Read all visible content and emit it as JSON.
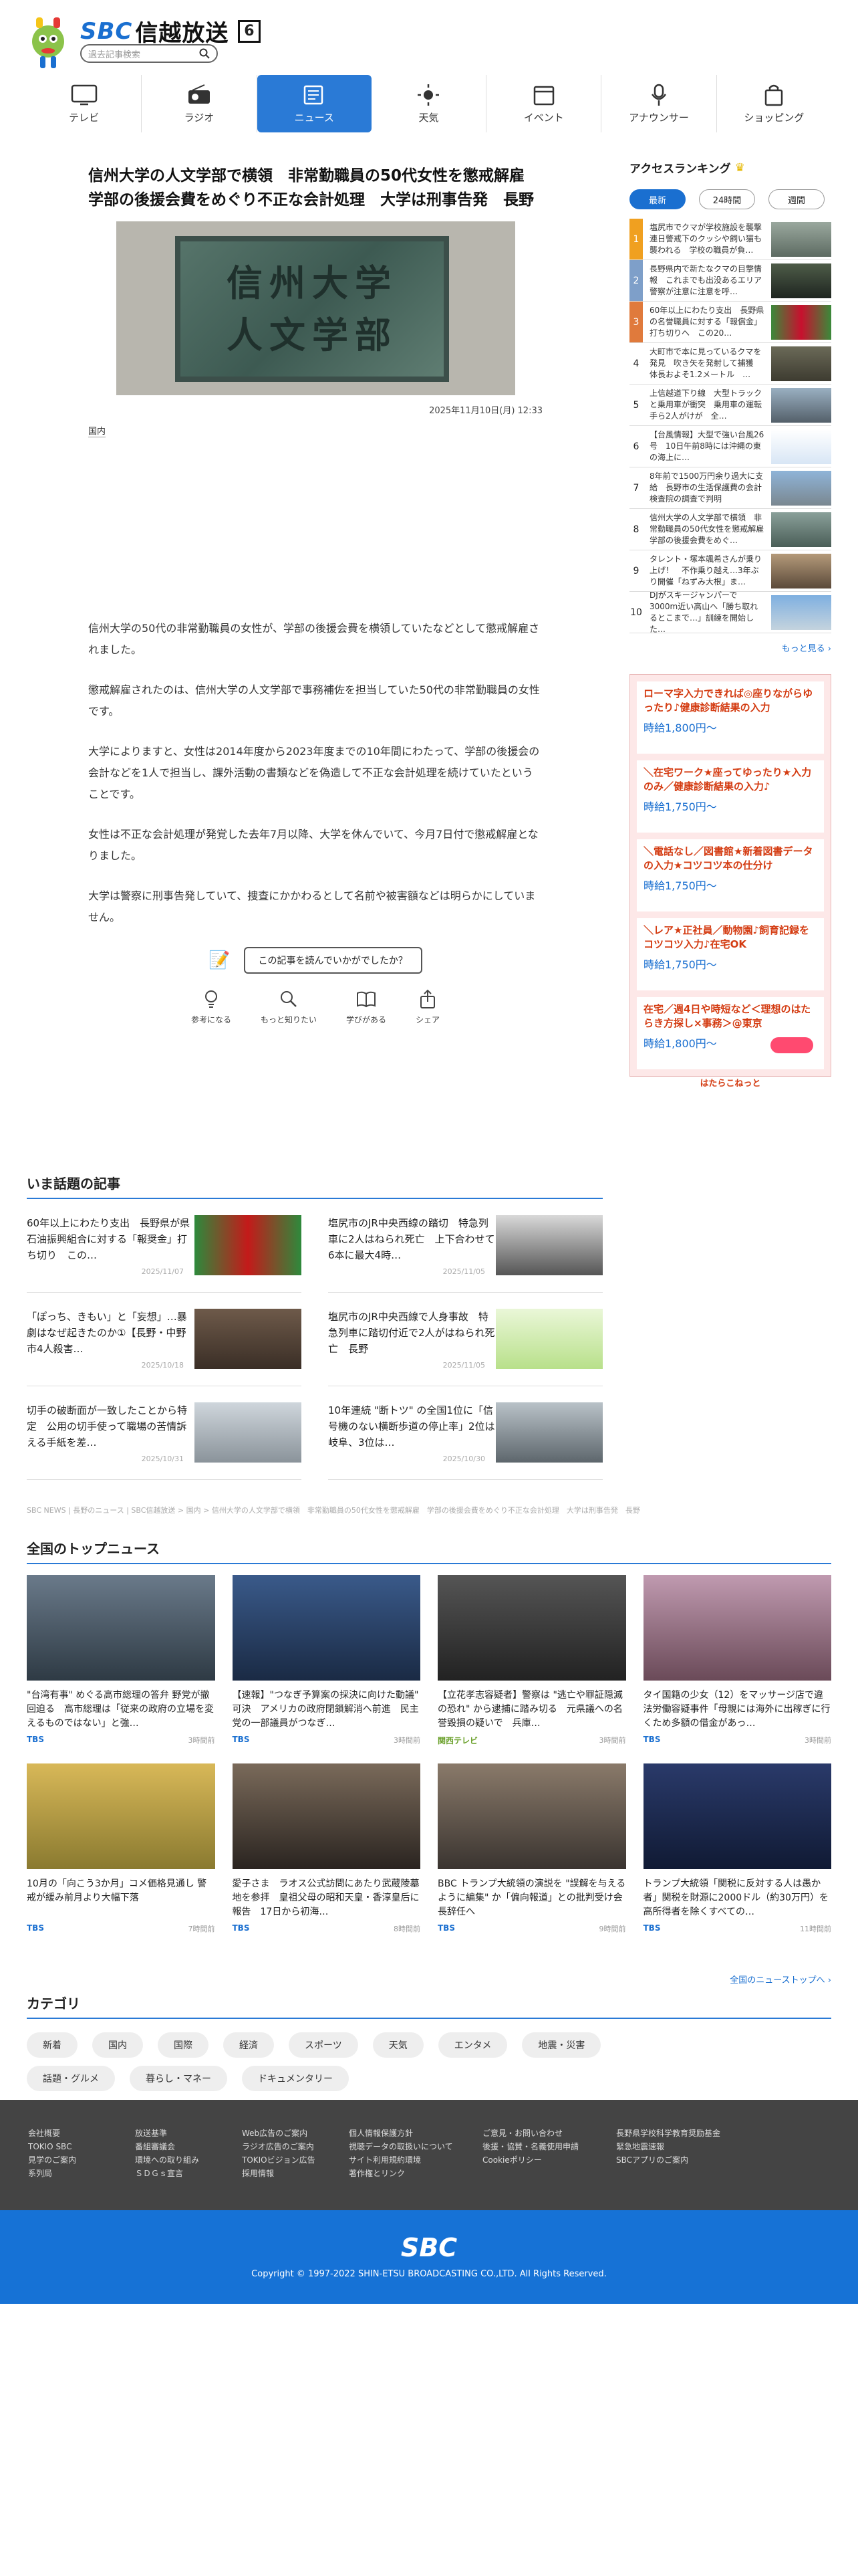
{
  "header": {
    "logo_sbc": "SBC",
    "logo_name": "信越放送",
    "channel": "6",
    "search_placeholder": "過去記事検索"
  },
  "nav": [
    {
      "label": "テレビ",
      "icon": "tv-icon"
    },
    {
      "label": "ラジオ",
      "icon": "radio-icon"
    },
    {
      "label": "ニュース",
      "icon": "news-icon",
      "active": true
    },
    {
      "label": "天気",
      "icon": "sun-icon"
    },
    {
      "label": "イベント",
      "icon": "calendar-icon"
    },
    {
      "label": "アナウンサー",
      "icon": "microphone-icon"
    },
    {
      "label": "ショッピング",
      "icon": "shopping-bag-icon"
    }
  ],
  "article": {
    "title": "信州大学の人文学部で横領　非常勤職員の50代女性を懲戒解雇　学部の後援会費をめぐり不正な会計処理　大学は刑事告発　長野",
    "plaque_line1": "信州大学",
    "plaque_line2": "人文学部",
    "date": "2025年11月10日(月) 12:33",
    "tag": "国内",
    "paragraphs": [
      "信州大学の50代の非常勤職員の女性が、学部の後援会費を横領していたなどとして懲戒解雇されました。",
      "懲戒解雇されたのは、信州大学の人文学部で事務補佐を担当していた50代の非常勤職員の女性です。",
      "大学によりますと、女性は2014年度から2023年度までの10年間にわたって、学部の後援会の会計などを1人で担当し、課外活動の書類などを偽造して不正な会計処理を続けていたということです。",
      "女性は不正な会計処理が発覚した去年7月以降、大学を休んでいて、今月7日付で懲戒解雇となりました。",
      "大学は警察に刑事告発していて、捜査にかかわるとして名前や被害額などは明らかにしていません。"
    ],
    "feedback_question": "この記事を読んでいかがでしたか？",
    "reactions": [
      {
        "label": "参考になる",
        "icon": "lightbulb-icon"
      },
      {
        "label": "もっと知りたい",
        "icon": "magnifier-icon"
      },
      {
        "label": "学びがある",
        "icon": "book-icon"
      },
      {
        "label": "シェア",
        "icon": "share-icon"
      }
    ]
  },
  "ranking": {
    "title": "アクセスランキング",
    "tabs": [
      "最新",
      "24時間",
      "週間"
    ],
    "items": [
      {
        "n": "1",
        "text": "塩尻市でクマが学校施設を襲撃　連日警戒下のクッシや飼い猫も襲われる　学校の職員が負…"
      },
      {
        "n": "2",
        "text": "長野県内で新たなクマの目撃情報　これまでも出没あるエリア　警察が注意に注意を呼…"
      },
      {
        "n": "3",
        "text": "60年以上にわたり支出　長野県の名誉職員に対する「報償金」打ち切りへ　この20…"
      },
      {
        "n": "4",
        "text": "大町市で本に見っているクマを発見　吹き矢を発射して捕獲　体長およそ1.2メートル　…"
      },
      {
        "n": "5",
        "text": "上信越道下り線　大型トラックと乗用車が衝突　乗用車の運転手ら2人がけが　全…"
      },
      {
        "n": "6",
        "text": "【台風情報】大型で強い台風26号　10日午前8時には沖縄の東の海上に…"
      },
      {
        "n": "7",
        "text": "8年前で1500万円余り過大に支給　長野市の生活保護費の会計検査院の調査で判明"
      },
      {
        "n": "8",
        "text": "信州大学の人文学部で横領　非常勤職員の50代女性を懲戒解雇　学部の後援会費をめぐ…"
      },
      {
        "n": "9",
        "text": "タレント・塚本颯希さんが乗り上げ！　不作乗り越え…3年ぶり開催「ねずみ大根」ま…"
      },
      {
        "n": "10",
        "text": "DJがスキージャンパーで3000m近い高山へ「勝ち取れるとこまで…」訓練を開始した…"
      }
    ],
    "more": "もっと見る"
  },
  "ad": {
    "blocks": [
      {
        "text": "ローマ字入力できれば◎座りながらゆったり♪健康診断結果の入力",
        "price": "時給1,800円〜"
      },
      {
        "text": "＼在宅ワーク★座ってゆったり★入力のみ／健康診断結果の入力♪",
        "price": "時給1,750円〜"
      },
      {
        "text": "＼電話なし／図書館★新着図書データの入力★コツコツ本の仕分け",
        "price": "時給1,750円〜"
      },
      {
        "text": "＼レア★正社員／動物園♪飼育記録をコツコツ入力♪在宅OK",
        "price": "時給1,750円〜"
      },
      {
        "text": "在宅／週4日や時短など＜理想のはたらき方探し×事務＞@東京",
        "price": "時給1,800円〜"
      }
    ],
    "footer": "はたらこねっと"
  },
  "hot": {
    "title": "いま話題の記事",
    "items": [
      {
        "text": "60年以上にわたり支出　長野県が県石油振興組合に対する「報奨金」打ち切り　この…",
        "date": "2025/11/07"
      },
      {
        "text": "塩尻市のJR中央西線の踏切　特急列車に2人はねられ死亡　上下合わせて6本に最大4時…",
        "date": "2025/11/05"
      },
      {
        "text": "「ぽっち、きもい」と「妄想」…暴劇はなぜ起きたのか①【長野・中野市4人殺害…",
        "date": "2025/10/18"
      },
      {
        "text": "塩尻市のJR中央西線で人身事故　特急列車に踏切付近で2人がはねられ死亡　長野",
        "date": "2025/11/05"
      },
      {
        "text": "切手の破断面が一致したことから特定　公用の切手使って職場の苦情訴える手紙を差…",
        "date": "2025/10/31"
      },
      {
        "text": "10年連続 \"断トツ\" の全国1位に「信号機のない横断歩道の停止率」2位は岐阜、3位は…",
        "date": "2025/10/30"
      }
    ]
  },
  "breadcrumb": "SBC NEWS | 長野のニュース | SBC信越放送 > 国内 > 信州大学の人文学部で横領　非常勤職員の50代女性を懲戒解雇　学部の後援会費をめぐり不正な会計処理　大学は刑事告発　長野",
  "topnews": {
    "title": "全国のトップニュース",
    "items": [
      {
        "text": "\"台湾有事\" めぐる高市総理の答弁 野党が撤回迫る　高市総理は「従来の政府の立場を変えるものではない」と強…",
        "src": "TBS",
        "ago": "3時間前"
      },
      {
        "text": "【速報】\"つなぎ予算案の採決に向けた動議\" 可決　アメリカの政府閉鎖解消へ前進　民主党の一部議員がつなぎ…",
        "src": "TBS",
        "ago": "3時間前"
      },
      {
        "text": "【立花孝志容疑者】警察は \"逃亡や罪証隠滅の恐れ\" から逮捕に踏み切る　元県議への名誉毀損の疑いで　兵庫…",
        "src": "関西テレビ",
        "ago": "3時間前"
      },
      {
        "text": "タイ国籍の少女（12）をマッサージ店で違法労働容疑事件「母親には海外に出稼ぎに行くため多額の借金があっ…",
        "src": "TBS",
        "ago": "3時間前"
      },
      {
        "text": "10月の「向こう3か月」コメ価格見通し 警戒が緩み前月より大幅下落",
        "src": "TBS",
        "ago": "7時間前"
      },
      {
        "text": "愛子さま　ラオス公式訪問にあたり武蔵陵墓地を参拝　皇祖父母の昭和天皇・香淳皇后に報告　17日から初海…",
        "src": "TBS",
        "ago": "8時間前"
      },
      {
        "text": "BBC トランプ大統領の演説を \"誤解を与えるように編集\" か「偏向報道」との批判受け会長辞任へ",
        "src": "TBS",
        "ago": "9時間前"
      },
      {
        "text": "トランプ大統領「関税に反対する人は愚か者」関税を財源に2000ドル（約30万円）を高所得者を除くすべての…",
        "src": "TBS",
        "ago": "11時間前"
      }
    ],
    "more": "全国のニューストップへ"
  },
  "categories": {
    "title": "カテゴリ",
    "items": [
      "新着",
      "国内",
      "国際",
      "経済",
      "スポーツ",
      "天気",
      "エンタメ",
      "地震・災害",
      "話題・グルメ",
      "暮らし・マネー",
      "ドキュメンタリー"
    ]
  },
  "footer": {
    "cols": [
      [
        "会社概要",
        "TOKIO SBC",
        "見学のご案内",
        "系列局"
      ],
      [
        "放送基準",
        "番組審議会",
        "環境への取り組み",
        "ＳＤＧｓ宣言"
      ],
      [
        "Web広告のご案内",
        "ラジオ広告のご案内",
        "TOKIOビジョン広告",
        "採用情報"
      ],
      [
        "個人情報保護方針",
        "視聴データの取扱いについて",
        "サイト利用規約環境",
        "著作権とリンク"
      ],
      [
        "ご意見・お問い合わせ",
        "後援・協賛・名義使用申請",
        "Cookieポリシー"
      ],
      [
        "長野県学校科学教育奨励基金",
        "緊急地震速報",
        "SBCアプリのご案内"
      ]
    ],
    "logo": "SBC",
    "copyright": "Copyright © 1997-2022 SHIN-ETSU BROADCASTING CO.,LTD. All Rights Reserved."
  }
}
